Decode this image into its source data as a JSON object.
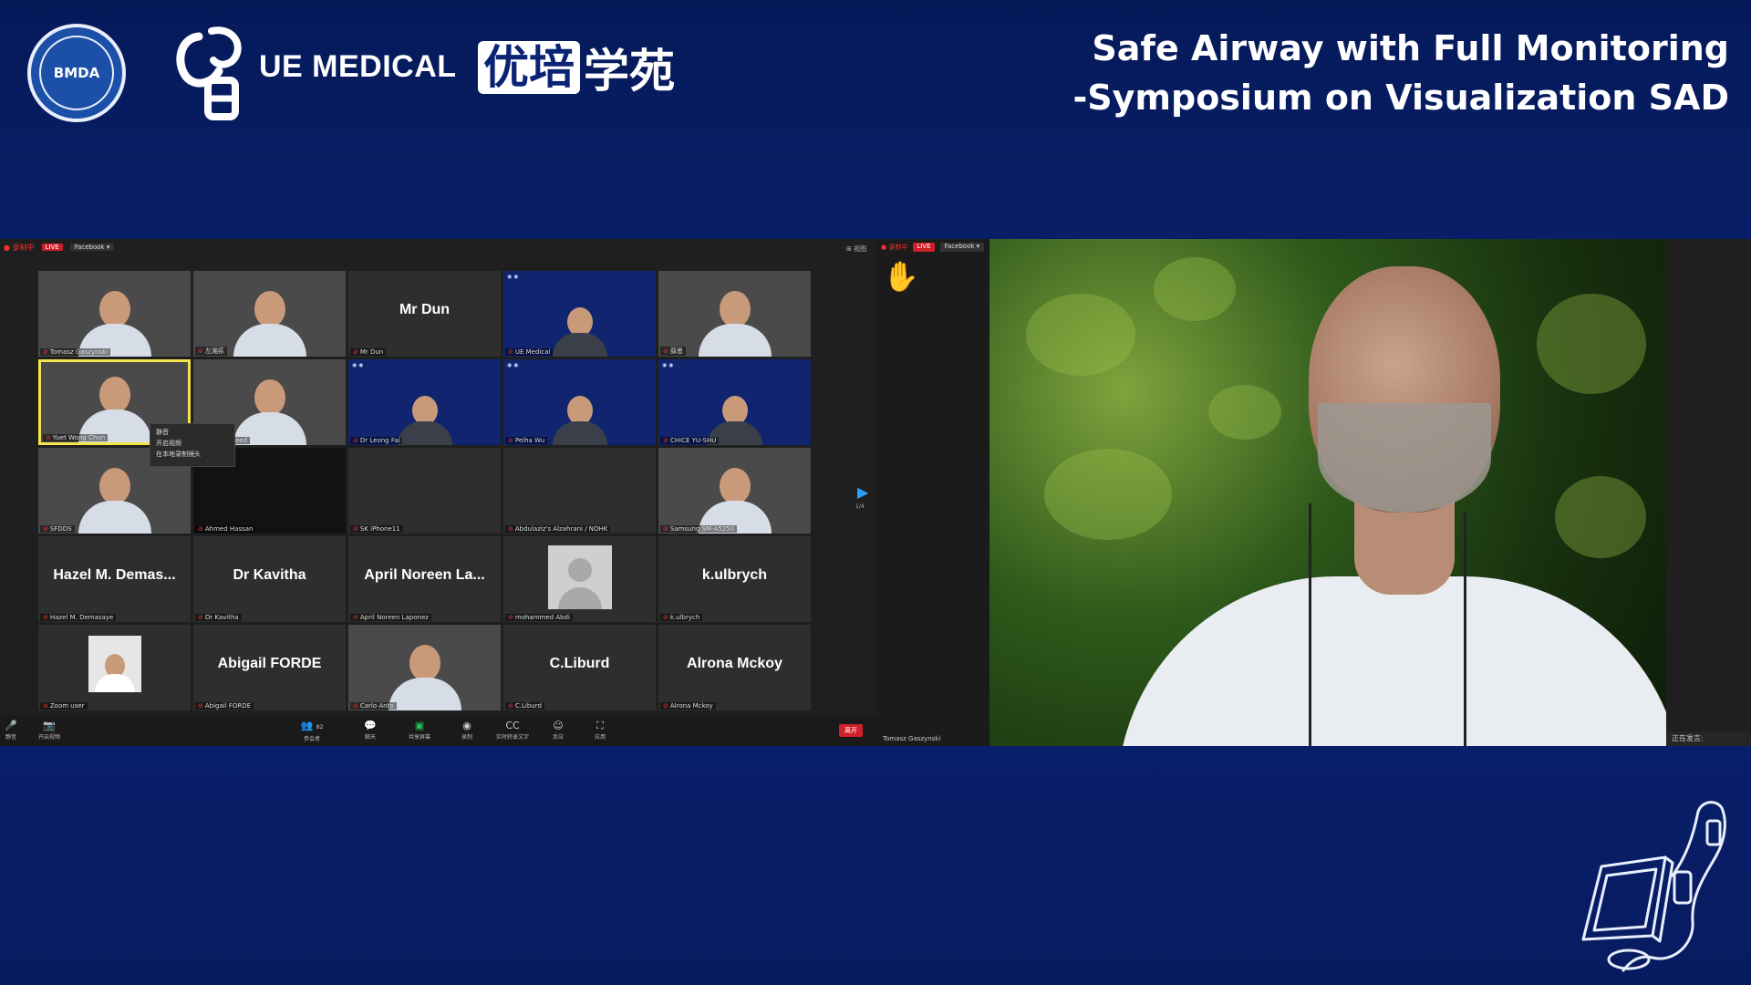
{
  "header": {
    "seal_text": "BMDA",
    "ue_brand": "UE MEDICAL",
    "cn_brand_box": "优培",
    "cn_brand_rest": "学苑",
    "title_line1": "Safe Airway with Full Monitoring",
    "title_line2": "-Symposium on Visualization SAD"
  },
  "zoom": {
    "top_bar": {
      "recording": "● 录制中",
      "live": "LIVE",
      "platform": "Facebook ▾",
      "grid_view": "⊞ 视图"
    },
    "tiles": [
      {
        "big": "",
        "small": "Tomasz Gaszynski",
        "kind": "video"
      },
      {
        "big": "",
        "small": "左湘荪",
        "kind": "video"
      },
      {
        "big": "Mr Dun",
        "small": "Mr Dun",
        "kind": "name"
      },
      {
        "big": "",
        "small": "UE Medical",
        "kind": "slide"
      },
      {
        "big": "",
        "small": "薛思",
        "kind": "video"
      },
      {
        "big": "",
        "small": "Yuet Wong Chun",
        "kind": "video"
      },
      {
        "big": "",
        "small": "Abdulmajeed",
        "kind": "video"
      },
      {
        "big": "",
        "small": "Dr Leong Fai",
        "kind": "slide"
      },
      {
        "big": "",
        "small": "Peiha Wu",
        "kind": "slide"
      },
      {
        "big": "",
        "small": "CHICE YU-SHU",
        "kind": "slide"
      },
      {
        "big": "",
        "small": "SFDDS",
        "kind": "video"
      },
      {
        "big": "",
        "small": "Ahmed Hassan",
        "kind": "blank"
      },
      {
        "big": "",
        "small": "SK iPhone11",
        "kind": "name"
      },
      {
        "big": "",
        "small": "Abdulaziz's Alzahrani / NOHK",
        "kind": "name"
      },
      {
        "big": "",
        "small": "Samsung SM-A5250",
        "kind": "video"
      },
      {
        "big": "Hazel M. Demas...",
        "small": "Hazel M. Demasaye",
        "kind": "name"
      },
      {
        "big": "Dr Kavitha",
        "small": "Dr Kavitha",
        "kind": "name"
      },
      {
        "big": "April Noreen La...",
        "small": "April Noreen Laponez",
        "kind": "name"
      },
      {
        "big": "",
        "small": "mohammed Abdi",
        "kind": "avatar"
      },
      {
        "big": "k.ulbrych",
        "small": "k.ulbrych",
        "kind": "name"
      },
      {
        "big": "",
        "small": "Zoom user",
        "kind": "thumb"
      },
      {
        "big": "Abigail FORDE",
        "small": "Abigail FORDE",
        "kind": "name"
      },
      {
        "big": "",
        "small": "Carlo Anto",
        "kind": "video"
      },
      {
        "big": "C.Liburd",
        "small": "C.Liburd",
        "kind": "name"
      },
      {
        "big": "Alrona Mckoy",
        "small": "Alrona Mckoy",
        "kind": "name"
      }
    ],
    "context_menu": [
      "静音",
      "开启视频",
      "在本地录制镜头"
    ],
    "page_indicator": "1/4",
    "toolbar": {
      "mute": "静音",
      "video": "开启视频",
      "participants": "参会者",
      "participants_count": "82",
      "chat": "聊天",
      "share": "共享屏幕",
      "record": "录制",
      "captions": "实时转录文字",
      "reactions": "反应",
      "apps": "应用",
      "end": "离开"
    },
    "strip": {
      "recording": "● 录制中",
      "live": "LIVE",
      "platform": "Facebook ▾",
      "name": "Tomasz Gaszynski"
    },
    "speaking_label": "正在发言:"
  },
  "colors": {
    "background": "#0a2374",
    "accent_live": "#d0202a",
    "active_border": "#f4e54a",
    "share_green": "#23c552"
  }
}
